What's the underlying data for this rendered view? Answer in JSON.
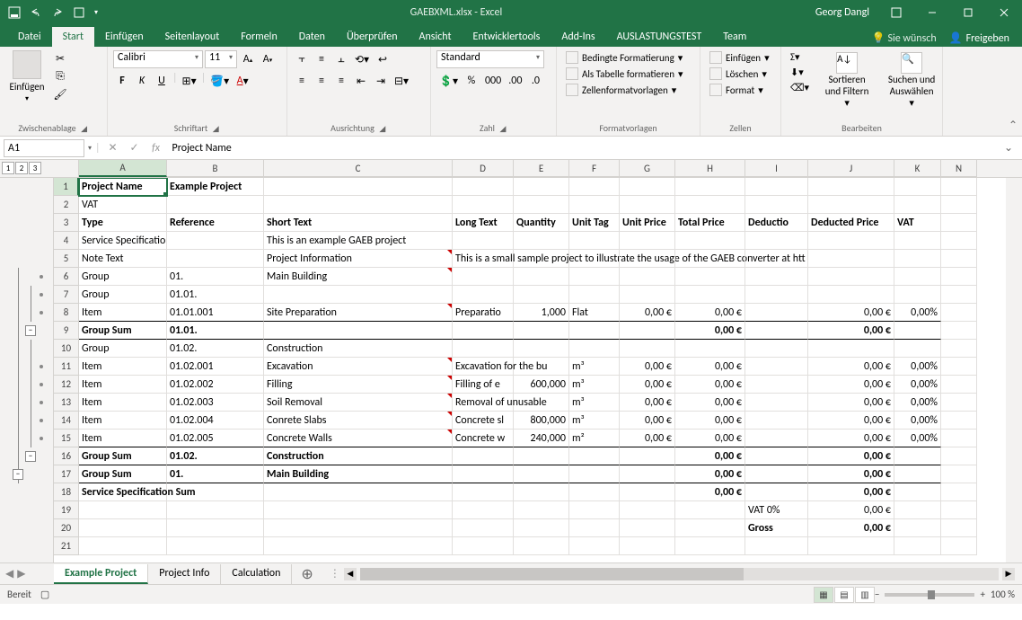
{
  "title": "GAEBXML.xlsx - Excel",
  "user": "Georg Dangl",
  "tabs": [
    "Datei",
    "Start",
    "Einfügen",
    "Seitenlayout",
    "Formeln",
    "Daten",
    "Überprüfen",
    "Ansicht",
    "Entwicklertools",
    "Add-Ins",
    "AUSLASTUNGSTEST",
    "Team"
  ],
  "active_tab": 1,
  "tell_me": "Sie wünsch",
  "share": "Freigeben",
  "ribbon": {
    "clipboard": {
      "label": "Zwischenablage",
      "paste": "Einfügen"
    },
    "font": {
      "label": "Schriftart",
      "name": "Calibri",
      "size": "11",
      "bold": "F",
      "italic": "K",
      "under": "U"
    },
    "align": {
      "label": "Ausrichtung"
    },
    "number": {
      "label": "Zahl",
      "format": "Standard",
      "thou": "000"
    },
    "styles": {
      "label": "Formatvorlagen",
      "cond": "Bedingte Formatierung",
      "table": "Als Tabelle formatieren",
      "cell": "Zellenformatvorlagen"
    },
    "cells": {
      "label": "Zellen",
      "insert": "Einfügen",
      "delete": "Löschen",
      "format": "Format"
    },
    "editing": {
      "label": "Bearbeiten",
      "sort": "Sortieren und Filtern",
      "find": "Suchen und Auswählen"
    }
  },
  "namebox": "A1",
  "formula": "Project Name",
  "outline_levels": [
    "1",
    "2",
    "3"
  ],
  "columns": [
    "A",
    "B",
    "C",
    "D",
    "E",
    "F",
    "G",
    "H",
    "I",
    "J",
    "K",
    "N"
  ],
  "col_classes": [
    "cA",
    "cB",
    "cC",
    "cD",
    "cE",
    "cF",
    "cG",
    "cH",
    "cI",
    "cJ",
    "cK",
    "cN"
  ],
  "rows": [
    {
      "n": 1,
      "cells": [
        {
          "c": "cA",
          "t": "Project Name",
          "b": 1,
          "a": 1
        },
        {
          "c": "cB",
          "t": "Example Project",
          "b": 1
        },
        {
          "c": "cC"
        },
        {
          "c": "cD"
        },
        {
          "c": "cE"
        },
        {
          "c": "cF"
        },
        {
          "c": "cG"
        },
        {
          "c": "cH"
        },
        {
          "c": "cI"
        },
        {
          "c": "cJ"
        },
        {
          "c": "cK"
        },
        {
          "c": "cN"
        }
      ]
    },
    {
      "n": 2,
      "cells": [
        {
          "c": "cA",
          "t": "VAT"
        },
        {
          "c": "cB"
        },
        {
          "c": "cC"
        },
        {
          "c": "cD"
        },
        {
          "c": "cE"
        },
        {
          "c": "cF"
        },
        {
          "c": "cG"
        },
        {
          "c": "cH"
        },
        {
          "c": "cI"
        },
        {
          "c": "cJ"
        },
        {
          "c": "cK"
        },
        {
          "c": "cN"
        }
      ]
    },
    {
      "n": 3,
      "cells": [
        {
          "c": "cA",
          "t": "Type",
          "b": 1
        },
        {
          "c": "cB",
          "t": "Reference",
          "b": 1
        },
        {
          "c": "cC",
          "t": "Short Text",
          "b": 1
        },
        {
          "c": "cD",
          "t": "Long Text",
          "b": 1
        },
        {
          "c": "cE",
          "t": "Quantity",
          "b": 1
        },
        {
          "c": "cF",
          "t": "Unit Tag",
          "b": 1
        },
        {
          "c": "cG",
          "t": "Unit Price",
          "b": 1
        },
        {
          "c": "cH",
          "t": "Total Price",
          "b": 1
        },
        {
          "c": "cI",
          "t": "Deductio",
          "b": 1
        },
        {
          "c": "cJ",
          "t": "Deducted Price",
          "b": 1
        },
        {
          "c": "cK",
          "t": "VAT",
          "b": 1
        },
        {
          "c": "cN"
        }
      ]
    },
    {
      "n": 4,
      "cells": [
        {
          "c": "cA",
          "t": "Service Specification"
        },
        {
          "c": "cB"
        },
        {
          "c": "cC",
          "t": "This is an example GAEB project"
        },
        {
          "c": "cD"
        },
        {
          "c": "cE"
        },
        {
          "c": "cF"
        },
        {
          "c": "cG"
        },
        {
          "c": "cH"
        },
        {
          "c": "cI"
        },
        {
          "c": "cJ"
        },
        {
          "c": "cK"
        },
        {
          "c": "cN"
        }
      ]
    },
    {
      "n": 5,
      "cells": [
        {
          "c": "cA",
          "t": "Note Text"
        },
        {
          "c": "cB"
        },
        {
          "c": "cC",
          "t": "Project Information",
          "ind": 1
        },
        {
          "c": "cD",
          "t": "This is a small sample project to illustrate the usage of the GAEB converter at htt",
          "of": 1
        },
        {
          "c": "cE"
        },
        {
          "c": "cF"
        },
        {
          "c": "cG"
        },
        {
          "c": "cH"
        },
        {
          "c": "cI"
        },
        {
          "c": "cJ"
        },
        {
          "c": "cK"
        },
        {
          "c": "cN"
        }
      ]
    },
    {
      "n": 6,
      "cells": [
        {
          "c": "cA",
          "t": "Group"
        },
        {
          "c": "cB",
          "t": "01."
        },
        {
          "c": "cC",
          "t": "Main Building",
          "ind": 1
        },
        {
          "c": "cD"
        },
        {
          "c": "cE"
        },
        {
          "c": "cF"
        },
        {
          "c": "cG"
        },
        {
          "c": "cH"
        },
        {
          "c": "cI"
        },
        {
          "c": "cJ"
        },
        {
          "c": "cK"
        },
        {
          "c": "cN"
        }
      ]
    },
    {
      "n": 7,
      "cells": [
        {
          "c": "cA",
          "t": "Group"
        },
        {
          "c": "cB",
          "t": "01.01."
        },
        {
          "c": "cC"
        },
        {
          "c": "cD"
        },
        {
          "c": "cE"
        },
        {
          "c": "cF"
        },
        {
          "c": "cG"
        },
        {
          "c": "cH"
        },
        {
          "c": "cI"
        },
        {
          "c": "cJ"
        },
        {
          "c": "cK"
        },
        {
          "c": "cN"
        }
      ]
    },
    {
      "n": 8,
      "cells": [
        {
          "c": "cA",
          "t": "Item",
          "bb": 1
        },
        {
          "c": "cB",
          "t": "01.01.001",
          "bb": 1
        },
        {
          "c": "cC",
          "t": "Site Preparation",
          "ind": 1,
          "bb": 1
        },
        {
          "c": "cD",
          "t": "Preparatio",
          "bb": 1
        },
        {
          "c": "cE",
          "t": "1,000",
          "r": 1,
          "bb": 1
        },
        {
          "c": "cF",
          "t": "Flat",
          "bb": 1
        },
        {
          "c": "cG",
          "t": "0,00 €",
          "r": 1,
          "bb": 1
        },
        {
          "c": "cH",
          "t": "0,00 €",
          "r": 1,
          "bb": 1
        },
        {
          "c": "cI",
          "bb": 1
        },
        {
          "c": "cJ",
          "t": "0,00 €",
          "r": 1,
          "bb": 1
        },
        {
          "c": "cK",
          "t": "0,00%",
          "r": 1,
          "bb": 1
        },
        {
          "c": "cN"
        }
      ]
    },
    {
      "n": 9,
      "cells": [
        {
          "c": "cA",
          "t": "Group Sum",
          "b": 1,
          "bb": 1
        },
        {
          "c": "cB",
          "t": "01.01.",
          "b": 1,
          "bb": 1
        },
        {
          "c": "cC",
          "bb": 1
        },
        {
          "c": "cD",
          "bb": 1
        },
        {
          "c": "cE",
          "bb": 1
        },
        {
          "c": "cF",
          "bb": 1
        },
        {
          "c": "cG",
          "bb": 1
        },
        {
          "c": "cH",
          "t": "0,00 €",
          "r": 1,
          "b": 1,
          "bb": 1
        },
        {
          "c": "cI",
          "bb": 1
        },
        {
          "c": "cJ",
          "t": "0,00 €",
          "r": 1,
          "b": 1,
          "bb": 1
        },
        {
          "c": "cK",
          "bb": 1
        },
        {
          "c": "cN"
        }
      ]
    },
    {
      "n": 10,
      "cells": [
        {
          "c": "cA",
          "t": "Group"
        },
        {
          "c": "cB",
          "t": "01.02."
        },
        {
          "c": "cC",
          "t": "Construction"
        },
        {
          "c": "cD"
        },
        {
          "c": "cE"
        },
        {
          "c": "cF"
        },
        {
          "c": "cG"
        },
        {
          "c": "cH"
        },
        {
          "c": "cI"
        },
        {
          "c": "cJ"
        },
        {
          "c": "cK"
        },
        {
          "c": "cN"
        }
      ]
    },
    {
      "n": 11,
      "cells": [
        {
          "c": "cA",
          "t": "Item"
        },
        {
          "c": "cB",
          "t": "01.02.001"
        },
        {
          "c": "cC",
          "t": "Excavation",
          "ind": 1
        },
        {
          "c": "cD",
          "t": "Excavation for the bu",
          "of": 1
        },
        {
          "c": "cE"
        },
        {
          "c": "cF",
          "t": "m³"
        },
        {
          "c": "cG",
          "t": "0,00 €",
          "r": 1
        },
        {
          "c": "cH",
          "t": "0,00 €",
          "r": 1
        },
        {
          "c": "cI"
        },
        {
          "c": "cJ",
          "t": "0,00 €",
          "r": 1
        },
        {
          "c": "cK",
          "t": "0,00%",
          "r": 1
        },
        {
          "c": "cN"
        }
      ]
    },
    {
      "n": 12,
      "cells": [
        {
          "c": "cA",
          "t": "Item"
        },
        {
          "c": "cB",
          "t": "01.02.002"
        },
        {
          "c": "cC",
          "t": "Filling",
          "ind": 1
        },
        {
          "c": "cD",
          "t": "Filling of e"
        },
        {
          "c": "cE",
          "t": "600,000",
          "r": 1
        },
        {
          "c": "cF",
          "t": "m³"
        },
        {
          "c": "cG",
          "t": "0,00 €",
          "r": 1
        },
        {
          "c": "cH",
          "t": "0,00 €",
          "r": 1
        },
        {
          "c": "cI"
        },
        {
          "c": "cJ",
          "t": "0,00 €",
          "r": 1
        },
        {
          "c": "cK",
          "t": "0,00%",
          "r": 1
        },
        {
          "c": "cN"
        }
      ]
    },
    {
      "n": 13,
      "cells": [
        {
          "c": "cA",
          "t": "Item"
        },
        {
          "c": "cB",
          "t": "01.02.003"
        },
        {
          "c": "cC",
          "t": "Soil Removal",
          "ind": 1
        },
        {
          "c": "cD",
          "t": "Removal of unusable",
          "of": 1
        },
        {
          "c": "cE"
        },
        {
          "c": "cF",
          "t": "m³"
        },
        {
          "c": "cG",
          "t": "0,00 €",
          "r": 1
        },
        {
          "c": "cH",
          "t": "0,00 €",
          "r": 1
        },
        {
          "c": "cI"
        },
        {
          "c": "cJ",
          "t": "0,00 €",
          "r": 1
        },
        {
          "c": "cK",
          "t": "0,00%",
          "r": 1
        },
        {
          "c": "cN"
        }
      ]
    },
    {
      "n": 14,
      "cells": [
        {
          "c": "cA",
          "t": "Item"
        },
        {
          "c": "cB",
          "t": "01.02.004"
        },
        {
          "c": "cC",
          "t": "Conrete Slabs",
          "ind": 1
        },
        {
          "c": "cD",
          "t": "Concrete sl"
        },
        {
          "c": "cE",
          "t": "800,000",
          "r": 1
        },
        {
          "c": "cF",
          "t": "m³"
        },
        {
          "c": "cG",
          "t": "0,00 €",
          "r": 1
        },
        {
          "c": "cH",
          "t": "0,00 €",
          "r": 1
        },
        {
          "c": "cI"
        },
        {
          "c": "cJ",
          "t": "0,00 €",
          "r": 1
        },
        {
          "c": "cK",
          "t": "0,00%",
          "r": 1
        },
        {
          "c": "cN"
        }
      ]
    },
    {
      "n": 15,
      "cells": [
        {
          "c": "cA",
          "t": "Item",
          "bb": 1
        },
        {
          "c": "cB",
          "t": "01.02.005",
          "bb": 1
        },
        {
          "c": "cC",
          "t": "Concrete Walls",
          "ind": 1,
          "bb": 1
        },
        {
          "c": "cD",
          "t": "Concrete w",
          "bb": 1
        },
        {
          "c": "cE",
          "t": "240,000",
          "r": 1,
          "bb": 1
        },
        {
          "c": "cF",
          "t": "m²",
          "bb": 1
        },
        {
          "c": "cG",
          "t": "0,00 €",
          "r": 1,
          "bb": 1
        },
        {
          "c": "cH",
          "t": "0,00 €",
          "r": 1,
          "bb": 1
        },
        {
          "c": "cI",
          "bb": 1
        },
        {
          "c": "cJ",
          "t": "0,00 €",
          "r": 1,
          "bb": 1
        },
        {
          "c": "cK",
          "t": "0,00%",
          "r": 1,
          "bb": 1
        },
        {
          "c": "cN"
        }
      ]
    },
    {
      "n": 16,
      "cells": [
        {
          "c": "cA",
          "t": "Group Sum",
          "b": 1,
          "bb": 1
        },
        {
          "c": "cB",
          "t": "01.02.",
          "b": 1,
          "bb": 1
        },
        {
          "c": "cC",
          "t": "Construction",
          "b": 1,
          "bb": 1
        },
        {
          "c": "cD",
          "bb": 1
        },
        {
          "c": "cE",
          "bb": 1
        },
        {
          "c": "cF",
          "bb": 1
        },
        {
          "c": "cG",
          "bb": 1
        },
        {
          "c": "cH",
          "t": "0,00 €",
          "r": 1,
          "b": 1,
          "bb": 1
        },
        {
          "c": "cI",
          "bb": 1
        },
        {
          "c": "cJ",
          "t": "0,00 €",
          "r": 1,
          "b": 1,
          "bb": 1
        },
        {
          "c": "cK",
          "bb": 1
        },
        {
          "c": "cN"
        }
      ]
    },
    {
      "n": 17,
      "cells": [
        {
          "c": "cA",
          "t": "Group Sum",
          "b": 1,
          "bb": 1
        },
        {
          "c": "cB",
          "t": "01.",
          "b": 1,
          "bb": 1
        },
        {
          "c": "cC",
          "t": "Main Building",
          "b": 1,
          "bb": 1
        },
        {
          "c": "cD",
          "bb": 1
        },
        {
          "c": "cE",
          "bb": 1
        },
        {
          "c": "cF",
          "bb": 1
        },
        {
          "c": "cG",
          "bb": 1
        },
        {
          "c": "cH",
          "t": "0,00 €",
          "r": 1,
          "b": 1,
          "bb": 1
        },
        {
          "c": "cI",
          "bb": 1
        },
        {
          "c": "cJ",
          "t": "0,00 €",
          "r": 1,
          "b": 1,
          "bb": 1
        },
        {
          "c": "cK",
          "bb": 1
        },
        {
          "c": "cN"
        }
      ]
    },
    {
      "n": 18,
      "cells": [
        {
          "c": "cA",
          "t": "Service Specification Sum",
          "b": 1,
          "of": 1
        },
        {
          "c": "cB"
        },
        {
          "c": "cC"
        },
        {
          "c": "cD"
        },
        {
          "c": "cE"
        },
        {
          "c": "cF"
        },
        {
          "c": "cG"
        },
        {
          "c": "cH",
          "t": "0,00 €",
          "r": 1,
          "b": 1
        },
        {
          "c": "cI"
        },
        {
          "c": "cJ",
          "t": "0,00 €",
          "r": 1,
          "b": 1
        },
        {
          "c": "cK"
        },
        {
          "c": "cN"
        }
      ]
    },
    {
      "n": 19,
      "cells": [
        {
          "c": "cA"
        },
        {
          "c": "cB"
        },
        {
          "c": "cC"
        },
        {
          "c": "cD"
        },
        {
          "c": "cE"
        },
        {
          "c": "cF"
        },
        {
          "c": "cG"
        },
        {
          "c": "cH"
        },
        {
          "c": "cI",
          "t": "VAT 0%"
        },
        {
          "c": "cJ",
          "t": "0,00 €",
          "r": 1
        },
        {
          "c": "cK"
        },
        {
          "c": "cN"
        }
      ]
    },
    {
      "n": 20,
      "cells": [
        {
          "c": "cA"
        },
        {
          "c": "cB"
        },
        {
          "c": "cC"
        },
        {
          "c": "cD"
        },
        {
          "c": "cE"
        },
        {
          "c": "cF"
        },
        {
          "c": "cG"
        },
        {
          "c": "cH"
        },
        {
          "c": "cI",
          "t": "Gross",
          "b": 1
        },
        {
          "c": "cJ",
          "t": "0,00 €",
          "r": 1,
          "b": 1
        },
        {
          "c": "cK"
        },
        {
          "c": "cN"
        }
      ]
    },
    {
      "n": 21,
      "cells": [
        {
          "c": "cA"
        },
        {
          "c": "cB"
        },
        {
          "c": "cC"
        },
        {
          "c": "cD"
        },
        {
          "c": "cE"
        },
        {
          "c": "cF"
        },
        {
          "c": "cG"
        },
        {
          "c": "cH"
        },
        {
          "c": "cI"
        },
        {
          "c": "cJ"
        },
        {
          "c": "cK"
        },
        {
          "c": "cN"
        }
      ]
    }
  ],
  "sheets": [
    "Example Project",
    "Project Info",
    "Calculation"
  ],
  "active_sheet": 0,
  "status": "Bereit",
  "zoom": "100 %"
}
